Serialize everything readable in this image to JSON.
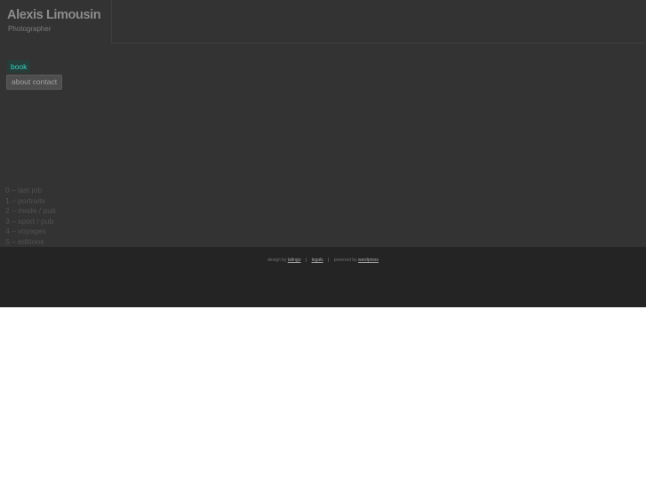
{
  "brand": {
    "name": "Alexis Limousin",
    "role": "Photographer"
  },
  "nav": {
    "book": "book",
    "about": "about",
    "contact": "contact"
  },
  "categories": [
    "0 – last job",
    "1 – portraits",
    "2 – mode / pub",
    "3 – sport / pub",
    "4 – voyages",
    "5 – editions"
  ],
  "footer": {
    "design_by": "design by",
    "design_link": "talingo",
    "separator": "|",
    "legals": "legals",
    "powered_by": "powered by",
    "powered_link": "wordpress"
  },
  "colors": {
    "background": "#333333",
    "footer": "#242424",
    "accent": "#36d0bf"
  }
}
